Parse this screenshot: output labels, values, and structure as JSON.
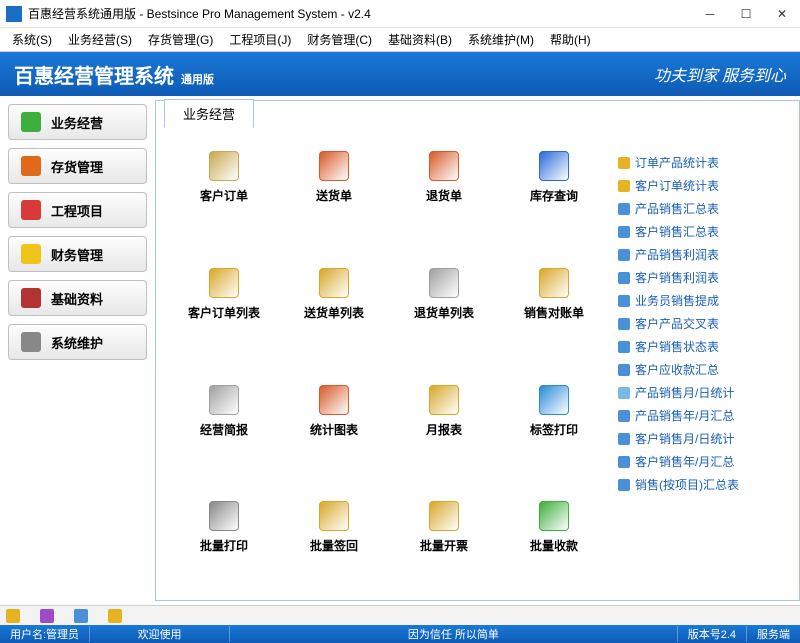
{
  "window": {
    "title": "百惠经营系统通用版 - Bestsince Pro Management System - v2.4"
  },
  "menu": [
    "系统(S)",
    "业务经营(S)",
    "存货管理(G)",
    "工程项目(J)",
    "财务管理(C)",
    "基础资料(B)",
    "系统维护(M)",
    "帮助(H)"
  ],
  "banner": {
    "title": "百惠经营管理系统",
    "subtitle": "通用版",
    "slogan": "功夫到家 服务到心"
  },
  "sidebar": [
    {
      "label": "业务经营",
      "color": "#3caf3c"
    },
    {
      "label": "存货管理",
      "color": "#e06a1a"
    },
    {
      "label": "工程项目",
      "color": "#d83a3a"
    },
    {
      "label": "财务管理",
      "color": "#f0c419"
    },
    {
      "label": "基础资料",
      "color": "#b43232"
    },
    {
      "label": "系统维护",
      "color": "#888888"
    }
  ],
  "tab": {
    "label": "业务经营"
  },
  "grid": [
    {
      "label": "客户订单",
      "color": "#c8a850"
    },
    {
      "label": "送货单",
      "color": "#d85a2a"
    },
    {
      "label": "退货单",
      "color": "#d85a2a"
    },
    {
      "label": "库存查询",
      "color": "#2a6ad8"
    },
    {
      "label": "客户订单列表",
      "color": "#d8a82a"
    },
    {
      "label": "送货单列表",
      "color": "#d8a82a"
    },
    {
      "label": "退货单列表",
      "color": "#a0a0a0"
    },
    {
      "label": "销售对账单",
      "color": "#d8a82a"
    },
    {
      "label": "经营简报",
      "color": "#a0a0a0"
    },
    {
      "label": "统计图表",
      "color": "#d85a2a"
    },
    {
      "label": "月报表",
      "color": "#d8a82a"
    },
    {
      "label": "标签打印",
      "color": "#2a8ad8"
    },
    {
      "label": "批量打印",
      "color": "#888888"
    },
    {
      "label": "批量签回",
      "color": "#d8a82a"
    },
    {
      "label": "批量开票",
      "color": "#d8a82a"
    },
    {
      "label": "批量收款",
      "color": "#3caf3c"
    }
  ],
  "reports": [
    {
      "label": "订单产品统计表",
      "color": "#e6b422"
    },
    {
      "label": "客户订单统计表",
      "color": "#e6b422"
    },
    {
      "label": "产品销售汇总表",
      "color": "#4a90d9"
    },
    {
      "label": "客户销售汇总表",
      "color": "#4a90d9"
    },
    {
      "label": "产品销售利润表",
      "color": "#4a90d9"
    },
    {
      "label": "客户销售利润表",
      "color": "#4a90d9"
    },
    {
      "label": "业务员销售提成",
      "color": "#4a90d9"
    },
    {
      "label": "客户产品交叉表",
      "color": "#4a90d9"
    },
    {
      "label": "客户销售状态表",
      "color": "#4a90d9"
    },
    {
      "label": "客户应收款汇总",
      "color": "#4a90d9"
    },
    {
      "label": "产品销售月/日统计",
      "color": "#7ab8e6"
    },
    {
      "label": "产品销售年/月汇总",
      "color": "#4a90d9"
    },
    {
      "label": "客户销售月/日统计",
      "color": "#4a90d9"
    },
    {
      "label": "客户销售年/月汇总",
      "color": "#4a90d9"
    },
    {
      "label": "销售(按项目)汇总表",
      "color": "#4a90d9"
    }
  ],
  "bottom_tools": [
    {
      "name": "tool-1",
      "color": "#e6b422"
    },
    {
      "name": "tool-2",
      "color": "#a04ac8"
    },
    {
      "name": "tool-3",
      "color": "#4a90d9"
    },
    {
      "name": "tool-4",
      "color": "#e6b422"
    }
  ],
  "status": {
    "user_label": "用户名:管理员",
    "welcome": "欢迎使用",
    "motto": "因为信任 所以简单",
    "version": "版本号2.4",
    "server": "服务端"
  }
}
